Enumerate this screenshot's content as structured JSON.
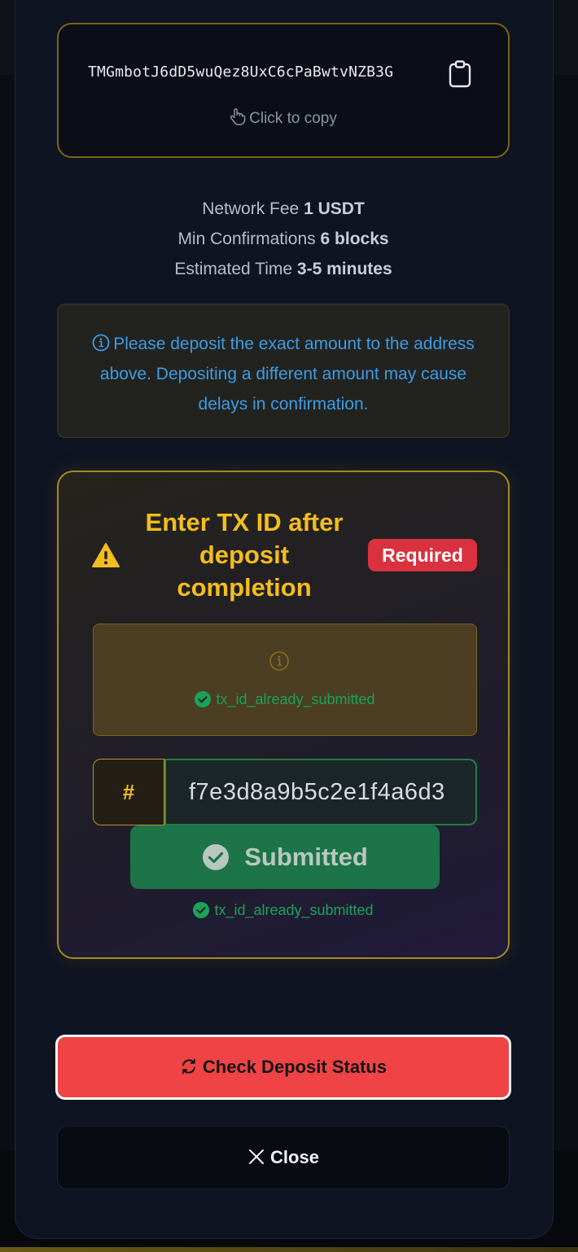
{
  "address": {
    "value": "TMGmbotJ6dD5wuQez8UxC6cPaBwtvNZB3G",
    "copy_hint": "Click to copy"
  },
  "fee_info": {
    "network_fee_label": "Network Fee",
    "network_fee_value": "1 USDT",
    "min_confirmations_label": "Min Confirmations",
    "min_confirmations_value": "6 blocks",
    "estimated_time_label": "Estimated Time",
    "estimated_time_value": "3-5 minutes"
  },
  "notice": {
    "text": "Please deposit the exact amount to the address above. Depositing a different amount may cause delays in confirmation."
  },
  "tx_section": {
    "title": "Enter TX ID after deposit completion",
    "required_badge": "Required",
    "status_message": "tx_id_already_submitted",
    "input_prefix": "#",
    "input_value": "f7e3d8a9b5c2e1f4a6d3",
    "submit_label": "Submitted",
    "below_status_message": "tx_id_already_submitted"
  },
  "actions": {
    "check_status_label": "Check Deposit Status",
    "close_label": "Close"
  },
  "colors": {
    "accent_gold": "#f3bd1d",
    "success_green": "#1aa35b",
    "danger_red": "#ef4346",
    "info_blue": "#3c9be6"
  }
}
